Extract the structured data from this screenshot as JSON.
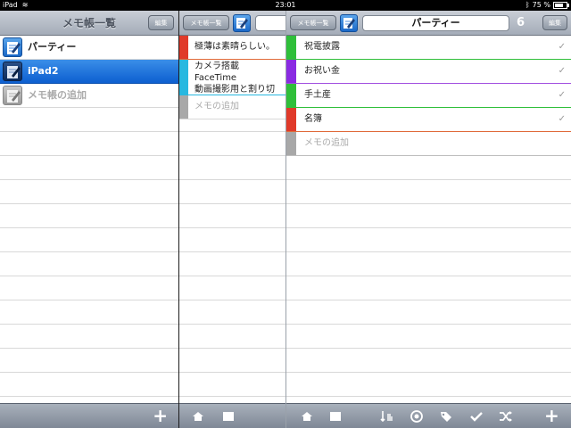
{
  "status_bar": {
    "device": "iPad",
    "time": "23:01",
    "battery": "75 %"
  },
  "left_pane": {
    "title": "メモ帳一覧",
    "edit_button": "編集",
    "items": [
      {
        "label": "パーティー",
        "state": "normal"
      },
      {
        "label": "iPad2",
        "state": "selected"
      },
      {
        "label": "メモ帳の追加",
        "state": "placeholder"
      }
    ]
  },
  "middle_pane": {
    "back_button": "メモ帳一覧",
    "memos": [
      {
        "lines": [
          "極薄は素晴らしい。"
        ],
        "color": "#e03a2a"
      },
      {
        "lines": [
          "カメラ搭載",
          "FaceTime",
          "動画撮影用と割り切"
        ],
        "color": "#28b8e0"
      },
      {
        "lines": [
          "メモの追加"
        ],
        "color": "#a8a8a8",
        "placeholder": true
      }
    ]
  },
  "right_pane": {
    "back_button": "メモ帳一覧",
    "title": "パーティー",
    "count": "6",
    "items": [
      {
        "label": "祝電披露",
        "color": "#2fbf3a",
        "line_color": "#2fbf3a",
        "checked": true
      },
      {
        "label": "お祝い金",
        "color": "#8a2be2",
        "line_color": "#a04de0",
        "checked": true
      },
      {
        "label": "手土産",
        "color": "#2fbf3a",
        "line_color": "#2fbf3a",
        "checked": true
      },
      {
        "label": "名簿",
        "color": "#e03a2a",
        "line_color": "#e06a3a",
        "checked": true
      },
      {
        "label": "メモの追加",
        "color": "#a8a8a8",
        "placeholder": true
      }
    ],
    "check_glyph": "✓"
  },
  "toolbar": {
    "add_glyph": "+",
    "icons": [
      "home-icon",
      "stop-icon",
      "sort-icon",
      "clock-icon",
      "tag-icon",
      "check-icon",
      "shuffle-icon",
      "add-icon"
    ]
  }
}
